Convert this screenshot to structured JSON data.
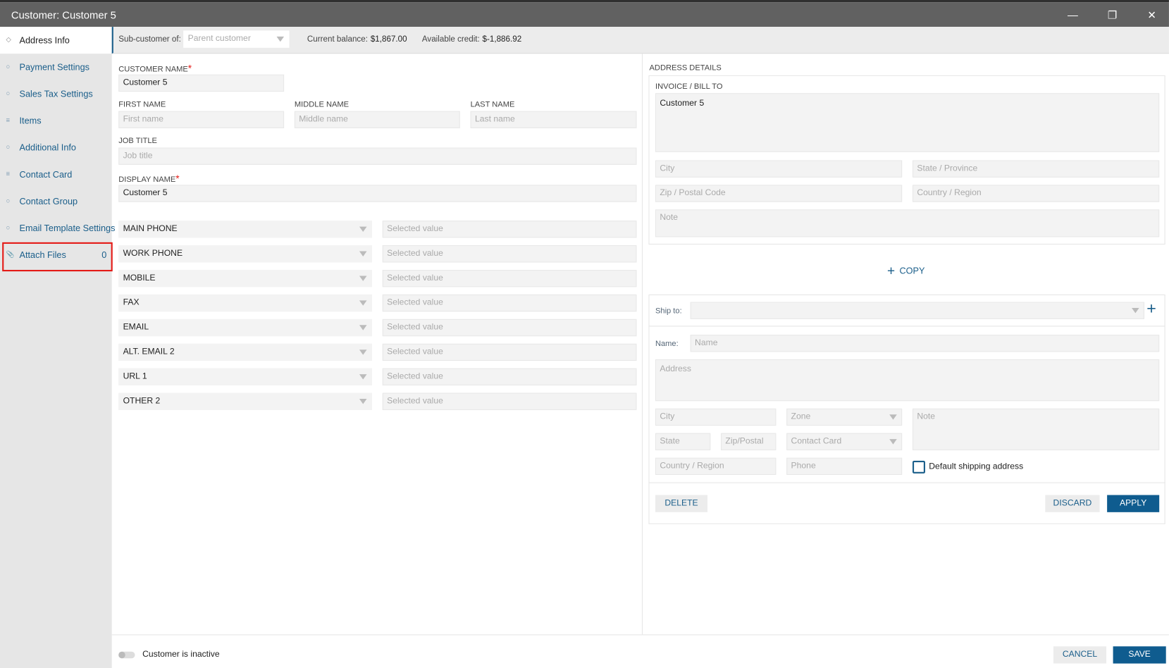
{
  "window": {
    "title": "Customer: Customer 5"
  },
  "sidebar": {
    "items": [
      {
        "label": "Address Info",
        "icon": "diamond-icon"
      },
      {
        "label": "Payment Settings",
        "icon": "circle-icon"
      },
      {
        "label": "Sales Tax Settings",
        "icon": "circle-icon"
      },
      {
        "label": "Items",
        "icon": "lines-icon"
      },
      {
        "label": "Additional Info",
        "icon": "circle-icon"
      },
      {
        "label": "Contact Card",
        "icon": "lines-icon"
      },
      {
        "label": "Contact Group",
        "icon": "circle-icon"
      },
      {
        "label": "Email Template Settings",
        "icon": "circle-icon"
      },
      {
        "label": "Attach Files",
        "icon": "paperclip-icon",
        "count": "0"
      }
    ]
  },
  "header": {
    "sub_customer_label": "Sub-customer of:",
    "sub_customer_placeholder": "Parent customer",
    "balance_label": "Current balance:",
    "balance_value": "$1,867.00",
    "credit_label": "Available credit:",
    "credit_value": "$-1,886.92"
  },
  "form": {
    "customer_name_label": "CUSTOMER NAME",
    "customer_name": "Customer 5",
    "first_name_label": "FIRST NAME",
    "first_name_ph": "First name",
    "middle_name_label": "MIDDLE NAME",
    "middle_name_ph": "Middle name",
    "last_name_label": "LAST NAME",
    "last_name_ph": "Last name",
    "job_title_label": "JOB TITLE",
    "job_title_ph": "Job title",
    "display_name_label": "DISPLAY NAME",
    "display_name": "Customer 5",
    "required_mark": "*",
    "contacts": [
      {
        "type": "MAIN PHONE",
        "ph": "Selected value"
      },
      {
        "type": "WORK PHONE",
        "ph": "Selected value"
      },
      {
        "type": "MOBILE",
        "ph": "Selected value"
      },
      {
        "type": "FAX",
        "ph": "Selected value"
      },
      {
        "type": "EMAIL",
        "ph": "Selected value"
      },
      {
        "type": "ALT. EMAIL 2",
        "ph": "Selected value"
      },
      {
        "type": "URL 1",
        "ph": "Selected value"
      },
      {
        "type": "OTHER 2",
        "ph": "Selected value"
      }
    ]
  },
  "address": {
    "title": "ADDRESS DETAILS",
    "bill_to_label": "INVOICE / BILL TO",
    "bill_to": "Customer 5",
    "city_ph": "City",
    "state_ph": "State / Province",
    "zip_ph": "Zip / Postal Code",
    "country_ph": "Country / Region",
    "note_ph": "Note",
    "copy_label": "COPY"
  },
  "ship": {
    "ship_to_label": "Ship to:",
    "name_label": "Name:",
    "name_ph": "Name",
    "address_ph": "Address",
    "city_ph": "City",
    "zone_ph": "Zone",
    "note_ph": "Note",
    "state_ph": "State",
    "zip_ph": "Zip/Postal",
    "contact_card_ph": "Contact Card",
    "country_ph": "Country / Region",
    "phone_ph": "Phone",
    "default_label": "Default shipping address",
    "default_checked": false,
    "delete_label": "DELETE",
    "discard_label": "DISCARD",
    "apply_label": "APPLY"
  },
  "footer": {
    "inactive_label": "Customer is inactive",
    "inactive": false,
    "cancel_label": "CANCEL",
    "save_label": "SAVE"
  },
  "colors": {
    "accent": "#0f5c8f",
    "link": "#1a5e8a",
    "titlebar": "#616161",
    "highlight": "#e41b17"
  }
}
